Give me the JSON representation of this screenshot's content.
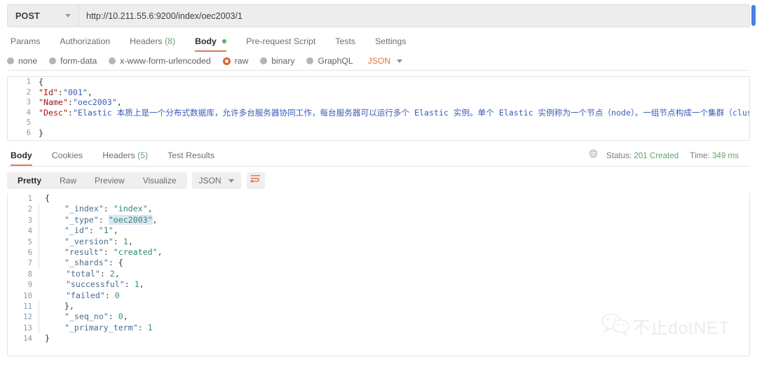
{
  "request": {
    "method": "POST",
    "url": "http://10.211.55.6:9200/index/oec2003/1",
    "tabs": [
      {
        "label": "Params",
        "count": "",
        "dot": false
      },
      {
        "label": "Authorization",
        "count": "",
        "dot": false
      },
      {
        "label": "Headers",
        "count": "(8)",
        "dot": false
      },
      {
        "label": "Body",
        "count": "",
        "dot": true
      },
      {
        "label": "Pre-request Script",
        "count": "",
        "dot": false
      },
      {
        "label": "Tests",
        "count": "",
        "dot": false
      },
      {
        "label": "Settings",
        "count": "",
        "dot": false
      }
    ],
    "active_tab": "Body",
    "body_types": [
      {
        "label": "none",
        "selected": false
      },
      {
        "label": "form-data",
        "selected": false
      },
      {
        "label": "x-www-form-urlencoded",
        "selected": false
      },
      {
        "label": "raw",
        "selected": true
      },
      {
        "label": "binary",
        "selected": false
      },
      {
        "label": "GraphQL",
        "selected": false
      }
    ],
    "raw_format": "JSON",
    "body_lines": [
      {
        "n": "1",
        "text": "{"
      },
      {
        "n": "2",
        "text": "\"Id\":\"001\","
      },
      {
        "n": "3",
        "text": "\"Name\":\"oec2003\","
      },
      {
        "n": "4",
        "text": "\"Desc\":\"Elastic 本质上是一个分布式数据库，允许多台服务器协同工作，每台服务器可以运行多个 Elastic 实例。单个 Elastic 实例称为一个节点（node）。一组节点构成一个集群（cluster）。\""
      },
      {
        "n": "5",
        "text": ""
      },
      {
        "n": "6",
        "text": "}"
      }
    ],
    "body_json": {
      "Id": "001",
      "Name": "oec2003",
      "Desc": "Elastic 本质上是一个分布式数据库，允许多台服务器协同工作，每台服务器可以运行多个 Elastic 实例。单个 Elastic 实例称为一个节点（node）。一组节点构成一个集群（cluster）。"
    }
  },
  "response": {
    "tabs": [
      {
        "label": "Body",
        "count": ""
      },
      {
        "label": "Cookies",
        "count": ""
      },
      {
        "label": "Headers",
        "count": "(5)"
      },
      {
        "label": "Test Results",
        "count": ""
      }
    ],
    "active_tab": "Body",
    "status_label": "Status:",
    "status_value": "201 Created",
    "time_label": "Time:",
    "time_value": "349 ms",
    "view_modes": [
      {
        "label": "Pretty",
        "active": true
      },
      {
        "label": "Raw",
        "active": false
      },
      {
        "label": "Preview",
        "active": false
      },
      {
        "label": "Visualize",
        "active": false
      }
    ],
    "format": "JSON",
    "wrap_icon": "wrap-text-icon",
    "body_json": {
      "_index": "index",
      "_type": "oec2003",
      "_id": "1",
      "_version": 1,
      "result": "created",
      "_shards": {
        "total": 2,
        "successful": 1,
        "failed": 0
      },
      "_seq_no": 0,
      "_primary_term": 1
    },
    "body_lines": [
      {
        "n": "1"
      },
      {
        "n": "2"
      },
      {
        "n": "3"
      },
      {
        "n": "4"
      },
      {
        "n": "5"
      },
      {
        "n": "6"
      },
      {
        "n": "7"
      },
      {
        "n": "8"
      },
      {
        "n": "9"
      },
      {
        "n": "10"
      },
      {
        "n": "11"
      },
      {
        "n": "12"
      },
      {
        "n": "13"
      },
      {
        "n": "14"
      }
    ]
  },
  "watermark": {
    "icon": "wechat-icon",
    "text": "不止dotNET"
  },
  "colors": {
    "accent": "#e07b53",
    "success": "#5fa760",
    "scrollbar": "#4a80e8"
  }
}
